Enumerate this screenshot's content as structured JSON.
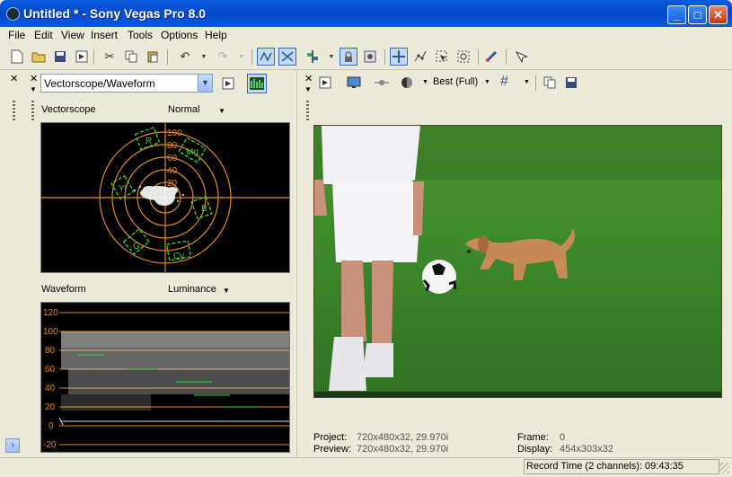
{
  "window": {
    "title": "Untitled * - Sony Vegas Pro 8.0",
    "minimize": "_",
    "maximize": "□",
    "close": "✕"
  },
  "menu": [
    "File",
    "Edit",
    "View",
    "Insert",
    "Tools",
    "Options",
    "Help"
  ],
  "scopes": {
    "selector_value": "Vectorscope/Waveform",
    "vectorscope": {
      "label": "Vectorscope",
      "mode": "Normal",
      "ring_labels": [
        "100",
        "80",
        "60",
        "40",
        "20"
      ],
      "targets": [
        "R",
        "Mg",
        "B",
        "Cy",
        "G",
        "Yl"
      ]
    },
    "waveform": {
      "label": "Waveform",
      "mode": "Luminance",
      "levels": [
        "120",
        "100",
        "80",
        "60",
        "40",
        "20",
        "0",
        "-20"
      ]
    }
  },
  "preview": {
    "quality": "Best (Full)"
  },
  "info": {
    "project_label": "Project:",
    "project_value": "720x480x32, 29.970i",
    "preview_label": "Preview:",
    "preview_value": "720x480x32, 29.970i",
    "frame_label": "Frame:",
    "frame_value": "0",
    "display_label": "Display:",
    "display_value": "454x303x32"
  },
  "status": {
    "record_time": "Record Time (2 channels): 09:43:35"
  },
  "colors": {
    "titlebar": "#0a5ddf",
    "scope_grid": "#e08a2a",
    "scope_target": "#3fd23f",
    "grass": "#3d8a2b"
  }
}
